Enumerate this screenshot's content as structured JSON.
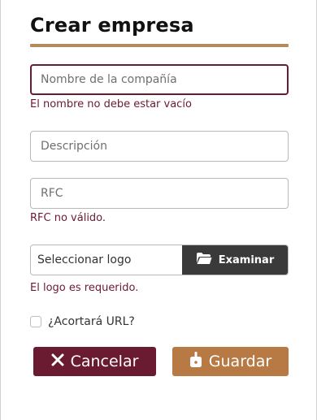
{
  "form": {
    "title": "Crear empresa",
    "name_field": {
      "placeholder": "Nombre de la compañía",
      "value": ""
    },
    "name_error": "El nombre no debe estar vacío",
    "description_field": {
      "placeholder": "Descripción",
      "value": ""
    },
    "rfc_field": {
      "placeholder": "RFC",
      "value": ""
    },
    "rfc_error": "RFC no válido.",
    "logo": {
      "text": "Seleccionar logo",
      "browse_label": "Examinar",
      "icon": "folder-open-icon"
    },
    "logo_error": "El logo es requerido.",
    "shorten_url": {
      "label": "¿Acortará URL?",
      "checked": false
    },
    "cancel_button": {
      "label": "Cancelar",
      "icon": "close-icon"
    },
    "save_button": {
      "label": "Guardar",
      "icon": "save-icon"
    }
  },
  "colors": {
    "accent_primary": "#6a1b31",
    "accent_secondary": "#b87a45",
    "title_rule": "#b68a5a",
    "file_button": "#3a3a3a"
  }
}
